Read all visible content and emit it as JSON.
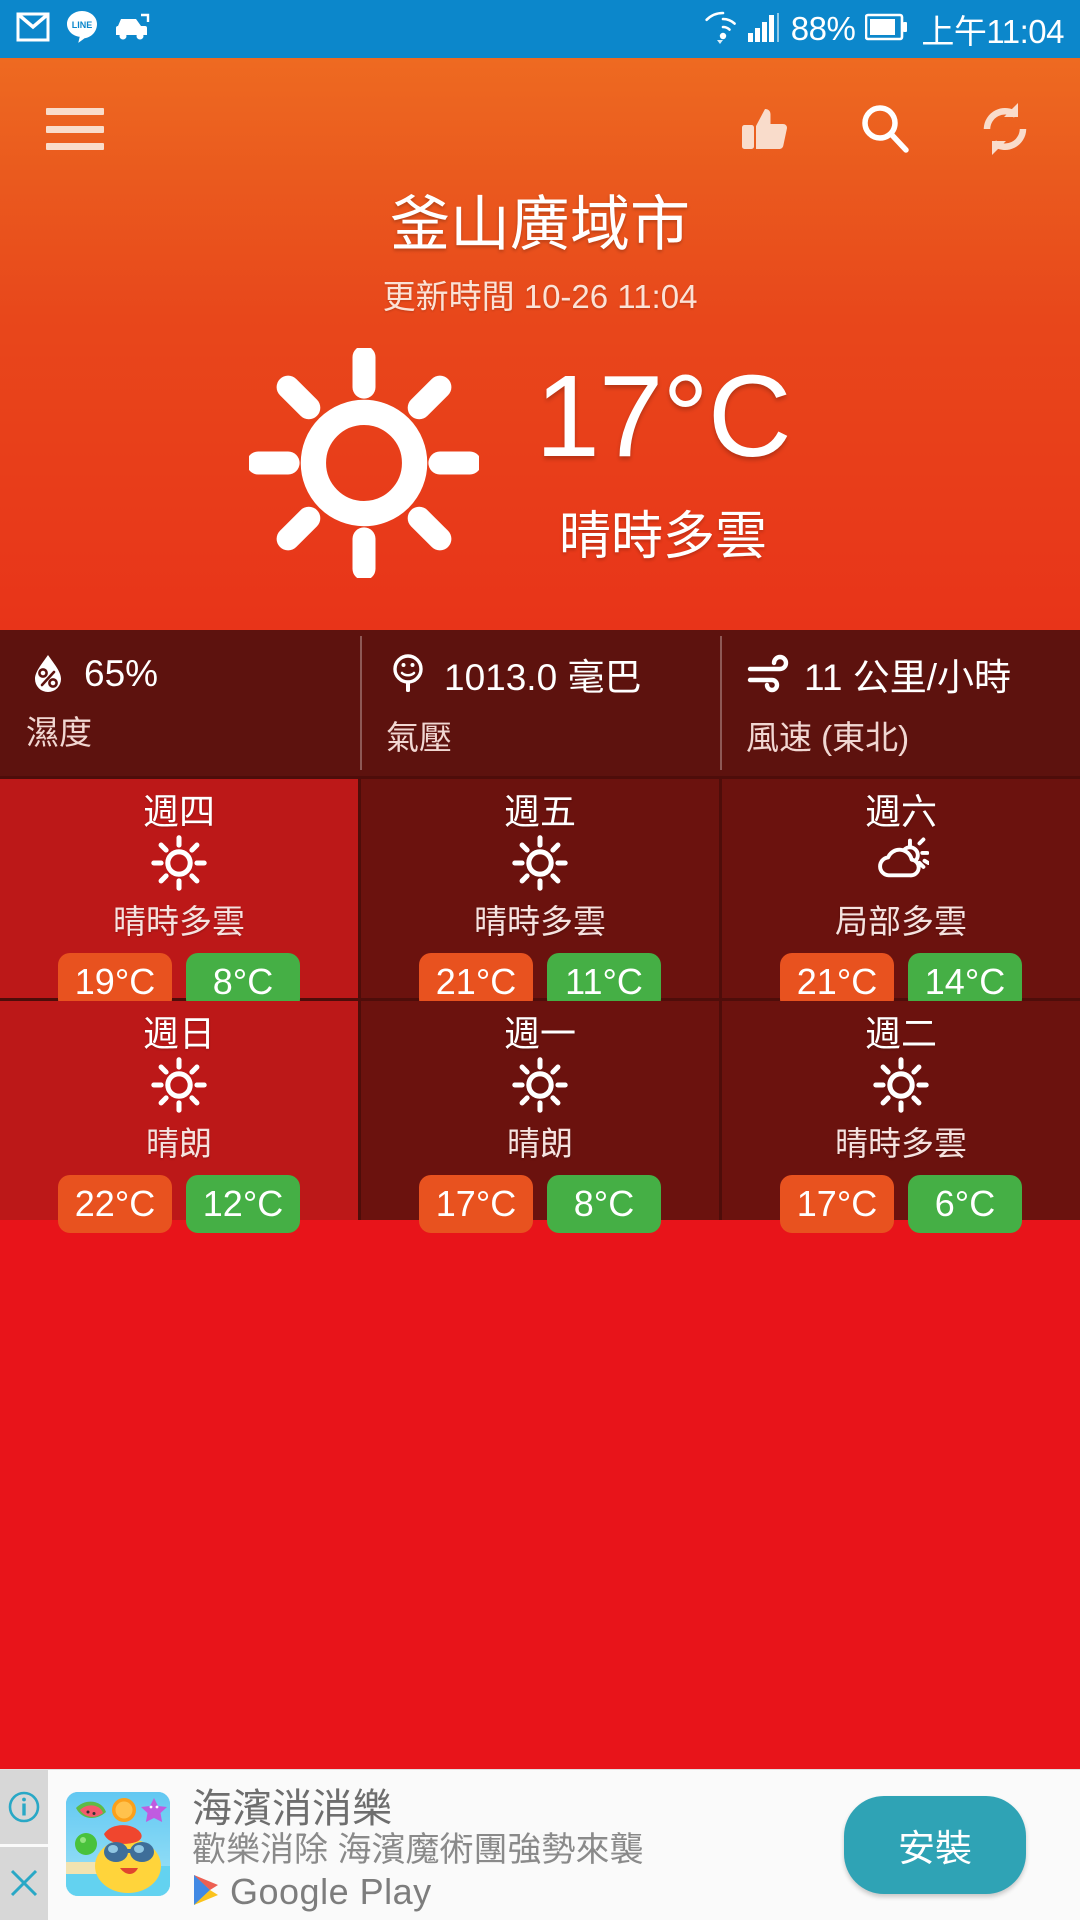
{
  "status_bar": {
    "background": "#0C87CB",
    "left_icons": [
      "gmail-icon",
      "line-icon",
      "car-icon"
    ],
    "right_icons": [
      "wifi-icon",
      "signal-icon",
      "battery-icon"
    ],
    "battery": "88%",
    "clock": "上午11:04"
  },
  "header": {
    "background": "#EA5A1E",
    "menu_icon": "hamburger-icon",
    "actions": [
      "thumbs-up-icon",
      "search-icon",
      "refresh-icon"
    ],
    "city": "釜山廣域市",
    "update_time": "更新時間 10-26 11:04"
  },
  "current": {
    "icon": "sun-icon",
    "temperature": "17°C",
    "description": "晴時多雲"
  },
  "details": [
    {
      "icon": "humidity-drop-icon",
      "value": "65%",
      "label": "濕度"
    },
    {
      "icon": "pressure-gauge-icon",
      "value": "1013.0 毫巴",
      "label": "氣壓"
    },
    {
      "icon": "wind-icon",
      "value": "11 公里/小時",
      "label": "風速 (東北)"
    }
  ],
  "forecast": [
    {
      "day": "週四",
      "icon": "sun-icon",
      "desc": "晴時多雲",
      "high": "19°C",
      "low": "8°C",
      "tone": "bright"
    },
    {
      "day": "週五",
      "icon": "sun-icon",
      "desc": "晴時多雲",
      "high": "21°C",
      "low": "11°C",
      "tone": "dark"
    },
    {
      "day": "週六",
      "icon": "cloud-sun-icon",
      "desc": "局部多雲",
      "high": "21°C",
      "low": "14°C",
      "tone": "dark"
    },
    {
      "day": "週日",
      "icon": "sun-icon",
      "desc": "晴朗",
      "high": "22°C",
      "low": "12°C",
      "tone": "bright"
    },
    {
      "day": "週一",
      "icon": "sun-icon",
      "desc": "晴朗",
      "high": "17°C",
      "low": "8°C",
      "tone": "dark"
    },
    {
      "day": "週二",
      "icon": "sun-icon",
      "desc": "晴時多雲",
      "high": "17°C",
      "low": "6°C",
      "tone": "dark"
    }
  ],
  "colors": {
    "high_badge": "#E8521F",
    "low_badge": "#45AF45",
    "cell_bright": "#BC1818",
    "cell_dark": "#6B120E",
    "detail_bar": "#5D120E",
    "page_red": "#E8141A",
    "install_teal": "#2FA3B5"
  },
  "ad": {
    "info_icon": "info-icon",
    "close_icon": "close-icon",
    "thumbnail": "game-app-icon",
    "title": "海濱消消樂",
    "subtitle": "歡樂消除 海濱魔術團強勢來襲",
    "store": "Google Play",
    "store_icon": "google-play-icon",
    "cta": "安裝"
  }
}
